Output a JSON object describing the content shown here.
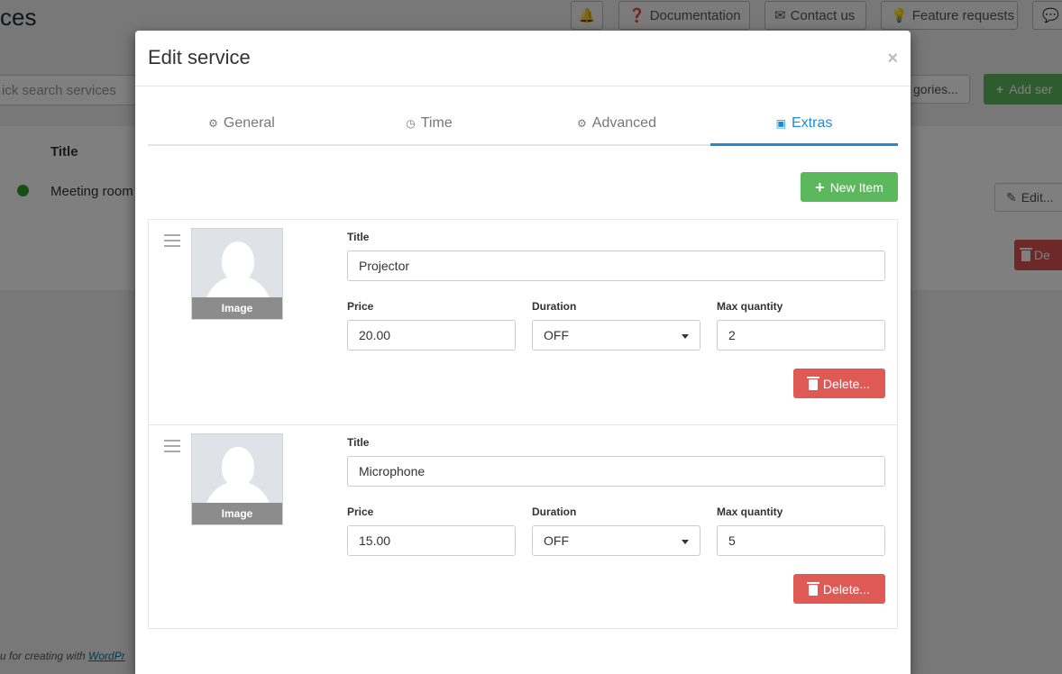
{
  "background": {
    "page_title": "ces",
    "top_buttons": [
      {
        "icon": "bell-icon",
        "label": ""
      },
      {
        "icon": "question-icon",
        "label": "Documentation"
      },
      {
        "icon": "envelope-icon",
        "label": "Contact us"
      },
      {
        "icon": "lightbulb-icon",
        "label": "Feature requests"
      },
      {
        "icon": "comment-icon",
        "label": ""
      }
    ],
    "search_placeholder": "ick search services",
    "categories_label": "gories...",
    "add_button_label": "Add ser",
    "table_header_title": "Title",
    "row_title": "Meeting room",
    "edit_label": "Edit...",
    "delete_label": "De",
    "footer_text": "u for creating with ",
    "footer_link": "WordPr"
  },
  "modal": {
    "title": "Edit service",
    "close_glyph": "×",
    "tabs": [
      {
        "label": "General",
        "icon": "gear-icon",
        "glyph": "⚙"
      },
      {
        "label": "Time",
        "icon": "clock-icon",
        "glyph": "◷"
      },
      {
        "label": "Advanced",
        "icon": "gears-icon",
        "glyph": "⚙"
      },
      {
        "label": "Extras",
        "icon": "briefcase-icon",
        "glyph": "▣"
      }
    ],
    "active_tab": "Extras",
    "new_item_label": "New Item",
    "image_caption": "Image",
    "labels": {
      "title": "Title",
      "price": "Price",
      "duration": "Duration",
      "max_quantity": "Max quantity",
      "delete": "Delete..."
    },
    "extras": [
      {
        "title": "Projector",
        "price": "20.00",
        "duration": "OFF",
        "max_quantity": "2"
      },
      {
        "title": "Microphone",
        "price": "15.00",
        "duration": "OFF",
        "max_quantity": "5"
      }
    ]
  },
  "colors": {
    "accent": "#1e8bd4",
    "success": "#5cb85c",
    "danger": "#e05a55",
    "status_dot": "#2e9c2e"
  }
}
